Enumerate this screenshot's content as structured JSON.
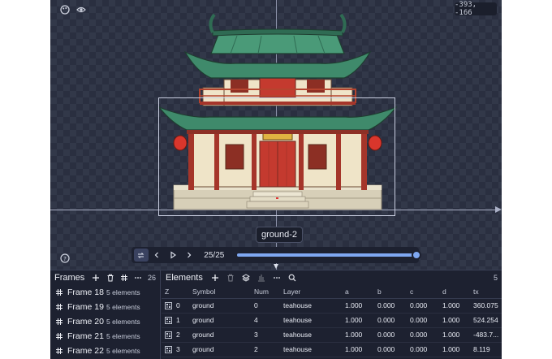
{
  "canvas": {
    "coords": "-393, -166",
    "tooltip": "ground-2",
    "tools": [
      "palette-icon",
      "eye-icon",
      "help-icon"
    ]
  },
  "playbar": {
    "counter": "25/25",
    "progress": 1.0,
    "accent": "#7fa8f2"
  },
  "frames": {
    "title": "Frames",
    "count": "26",
    "items": [
      {
        "name": "Frame 18",
        "elements": "5 elements"
      },
      {
        "name": "Frame 19",
        "elements": "5 elements"
      },
      {
        "name": "Frame 20",
        "elements": "5 elements"
      },
      {
        "name": "Frame 21",
        "elements": "5 elements"
      },
      {
        "name": "Frame 22",
        "elements": "5 elements"
      }
    ]
  },
  "elements": {
    "title": "Elements",
    "count": "5",
    "columns": [
      "Z",
      "Symbol",
      "Num",
      "Layer",
      "a",
      "b",
      "c",
      "d",
      "tx"
    ],
    "rows": [
      {
        "z": "0",
        "symbol": "ground",
        "num": "0",
        "layer": "teahouse",
        "a": "1.000",
        "b": "0.000",
        "c": "0.000",
        "d": "1.000",
        "tx": "360.075"
      },
      {
        "z": "1",
        "symbol": "ground",
        "num": "4",
        "layer": "teahouse",
        "a": "1.000",
        "b": "0.000",
        "c": "0.000",
        "d": "1.000",
        "tx": "524.254"
      },
      {
        "z": "2",
        "symbol": "ground",
        "num": "3",
        "layer": "teahouse",
        "a": "1.000",
        "b": "0.000",
        "c": "0.000",
        "d": "1.000",
        "tx": "-483.7..."
      },
      {
        "z": "3",
        "symbol": "ground",
        "num": "2",
        "layer": "teahouse",
        "a": "1.000",
        "b": "0.000",
        "c": "0.000",
        "d": "1.000",
        "tx": "8.119"
      }
    ]
  }
}
